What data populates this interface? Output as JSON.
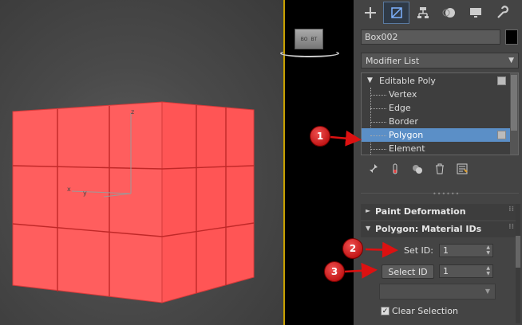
{
  "viewport": {
    "gizmo_labels": {
      "z": "z",
      "x": "x",
      "y": "y"
    },
    "viewcube_labels": [
      "BO",
      "BT"
    ],
    "object_color": "#ff5b5b"
  },
  "command_panel": {
    "tabs": [
      {
        "name": "create-tab",
        "icon": "plus-icon",
        "active": false
      },
      {
        "name": "modify-tab",
        "icon": "modify-icon",
        "active": true
      },
      {
        "name": "hierarchy-tab",
        "icon": "hierarchy-icon",
        "active": false
      },
      {
        "name": "motion-tab",
        "icon": "motion-icon",
        "active": false
      },
      {
        "name": "display-tab",
        "icon": "display-icon",
        "active": false
      },
      {
        "name": "utilities-tab",
        "icon": "wrench-icon",
        "active": false
      }
    ],
    "object_name": "Box002",
    "object_color": "#000000",
    "modifier_list": "Modifier List",
    "stack": {
      "root": "Editable Poly",
      "subobjects": [
        "Vertex",
        "Edge",
        "Border",
        "Polygon",
        "Element"
      ],
      "selected": "Polygon"
    },
    "rollouts": {
      "paint_deformation": "Paint Deformation",
      "material_ids": "Polygon: Material IDs"
    },
    "material_ids": {
      "set_id_label": "Set ID:",
      "set_id_value": "1",
      "select_id_button": "Select ID",
      "select_id_value": "1",
      "dropdown_value": "",
      "clear_selection_label": "Clear Selection",
      "clear_selection_checked": true
    }
  },
  "callouts": [
    "1",
    "2",
    "3"
  ],
  "accent_colors": {
    "selection": "#5b8fc7",
    "viewport_border": "#c8a000",
    "callout": "#cc1111"
  }
}
